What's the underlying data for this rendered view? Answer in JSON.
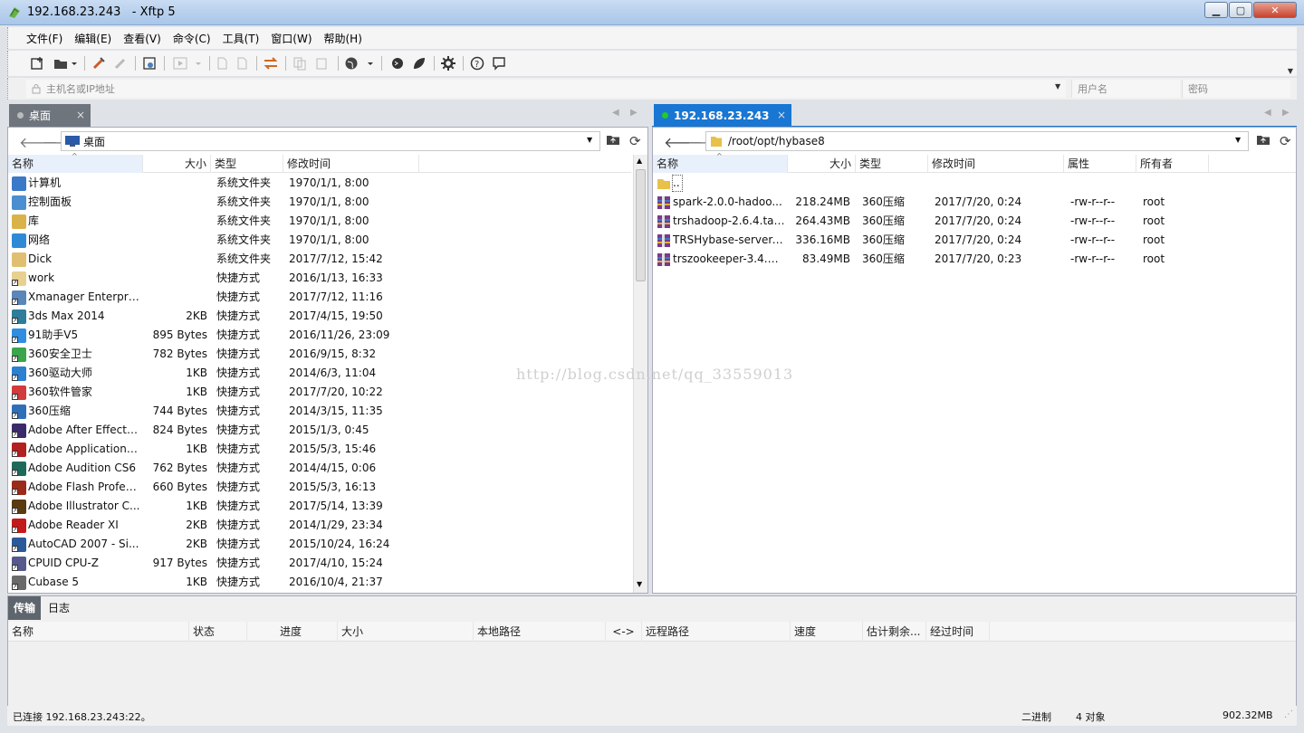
{
  "window": {
    "title": "192.168.23.243   - Xftp 5",
    "minimize": "▁",
    "maximize": "▢",
    "close": "✕"
  },
  "menu": [
    "文件(F)",
    "编辑(E)",
    "查看(V)",
    "命令(C)",
    "工具(T)",
    "窗口(W)",
    "帮助(H)"
  ],
  "addressbar": {
    "host_placeholder": "主机名或IP地址",
    "user_placeholder": "用户名",
    "password_placeholder": "密码"
  },
  "left": {
    "tab_label": "桌面",
    "tab_close": "×",
    "path": "桌面",
    "columns": [
      "名称",
      "大小",
      "类型",
      "修改时间"
    ],
    "rows": [
      {
        "name": "计算机",
        "size": "",
        "type": "系统文件夹",
        "modified": "1970/1/1, 8:00",
        "color": "#3a78c8"
      },
      {
        "name": "控制面板",
        "size": "",
        "type": "系统文件夹",
        "modified": "1970/1/1, 8:00",
        "color": "#4a8fd0"
      },
      {
        "name": "库",
        "size": "",
        "type": "系统文件夹",
        "modified": "1970/1/1, 8:00",
        "color": "#d9b24a"
      },
      {
        "name": "网络",
        "size": "",
        "type": "系统文件夹",
        "modified": "1970/1/1, 8:00",
        "color": "#2f8ad6"
      },
      {
        "name": "Dick",
        "size": "",
        "type": "系统文件夹",
        "modified": "2017/7/12, 15:42",
        "color": "#e0c070"
      },
      {
        "name": "work",
        "size": "",
        "type": "快捷方式",
        "modified": "2016/1/13, 16:33",
        "color": "#e8d090"
      },
      {
        "name": "Xmanager Enterpri...",
        "size": "",
        "type": "快捷方式",
        "modified": "2017/7/12, 11:16",
        "color": "#5a86b8"
      },
      {
        "name": "3ds Max 2014",
        "size": "2KB",
        "type": "快捷方式",
        "modified": "2017/4/15, 19:50",
        "color": "#2e7d9a"
      },
      {
        "name": "91助手V5",
        "size": "895 Bytes",
        "type": "快捷方式",
        "modified": "2016/11/26, 23:09",
        "color": "#2f8ee0"
      },
      {
        "name": "360安全卫士",
        "size": "782 Bytes",
        "type": "快捷方式",
        "modified": "2016/9/15, 8:32",
        "color": "#3aa54a"
      },
      {
        "name": "360驱动大师",
        "size": "1KB",
        "type": "快捷方式",
        "modified": "2014/6/3, 11:04",
        "color": "#2d7fd0"
      },
      {
        "name": "360软件管家",
        "size": "1KB",
        "type": "快捷方式",
        "modified": "2017/7/20, 10:22",
        "color": "#d23b3b"
      },
      {
        "name": "360压缩",
        "size": "744 Bytes",
        "type": "快捷方式",
        "modified": "2014/3/15, 11:35",
        "color": "#2f6fb8"
      },
      {
        "name": "Adobe After Effects...",
        "size": "824 Bytes",
        "type": "快捷方式",
        "modified": "2015/1/3, 0:45",
        "color": "#3a2a6a"
      },
      {
        "name": "Adobe Application ...",
        "size": "1KB",
        "type": "快捷方式",
        "modified": "2015/5/3, 15:46",
        "color": "#b22020"
      },
      {
        "name": "Adobe Audition CS6",
        "size": "762 Bytes",
        "type": "快捷方式",
        "modified": "2014/4/15, 0:06",
        "color": "#1e6a5a"
      },
      {
        "name": "Adobe Flash Profes...",
        "size": "660 Bytes",
        "type": "快捷方式",
        "modified": "2015/5/3, 16:13",
        "color": "#9a2a1a"
      },
      {
        "name": "Adobe Illustrator C...",
        "size": "1KB",
        "type": "快捷方式",
        "modified": "2017/5/14, 13:39",
        "color": "#5a3a10"
      },
      {
        "name": "Adobe Reader XI",
        "size": "2KB",
        "type": "快捷方式",
        "modified": "2014/1/29, 23:34",
        "color": "#c41a1a"
      },
      {
        "name": "AutoCAD 2007 - Si...",
        "size": "2KB",
        "type": "快捷方式",
        "modified": "2015/10/24, 16:24",
        "color": "#2a5a9a"
      },
      {
        "name": "CPUID CPU-Z",
        "size": "917 Bytes",
        "type": "快捷方式",
        "modified": "2017/4/10, 15:24",
        "color": "#555a8a"
      },
      {
        "name": "Cubase 5",
        "size": "1KB",
        "type": "快捷方式",
        "modified": "2016/10/4, 21:37",
        "color": "#6a6a6a"
      }
    ]
  },
  "right": {
    "tab_label": "192.168.23.243",
    "tab_close": "×",
    "path": "/root/opt/hybase8",
    "columns": [
      "名称",
      "大小",
      "类型",
      "修改时间",
      "属性",
      "所有者"
    ],
    "parent": "..",
    "rows": [
      {
        "name": "spark-2.0.0-hadoo...",
        "size": "218.24MB",
        "type": "360压缩",
        "modified": "2017/7/20, 0:24",
        "attr": "-rw-r--r--",
        "owner": "root"
      },
      {
        "name": "trshadoop-2.6.4.tar....",
        "size": "264.43MB",
        "type": "360压缩",
        "modified": "2017/7/20, 0:24",
        "attr": "-rw-r--r--",
        "owner": "root"
      },
      {
        "name": "TRSHybase-server-l...",
        "size": "336.16MB",
        "type": "360压缩",
        "modified": "2017/7/20, 0:24",
        "attr": "-rw-r--r--",
        "owner": "root"
      },
      {
        "name": "trszookeeper-3.4.6....",
        "size": "83.49MB",
        "type": "360压缩",
        "modified": "2017/7/20, 0:23",
        "attr": "-rw-r--r--",
        "owner": "root"
      }
    ]
  },
  "transfer": {
    "tabs": [
      "传输",
      "日志"
    ],
    "columns": [
      "名称",
      "状态",
      "进度",
      "大小",
      "本地路径",
      "<->",
      "远程路径",
      "速度",
      "估计剩余...",
      "经过时间"
    ]
  },
  "status": {
    "connection": "已连接 192.168.23.243:22。",
    "mode": "二进制",
    "objects": "4 对象",
    "size": "902.32MB"
  },
  "watermark": "http://blog.csdn.net/qq_33559013",
  "colors": {
    "accent": "#0a7fd6",
    "active_tab": "#1976d2",
    "connected_dot": "#22cc22"
  }
}
